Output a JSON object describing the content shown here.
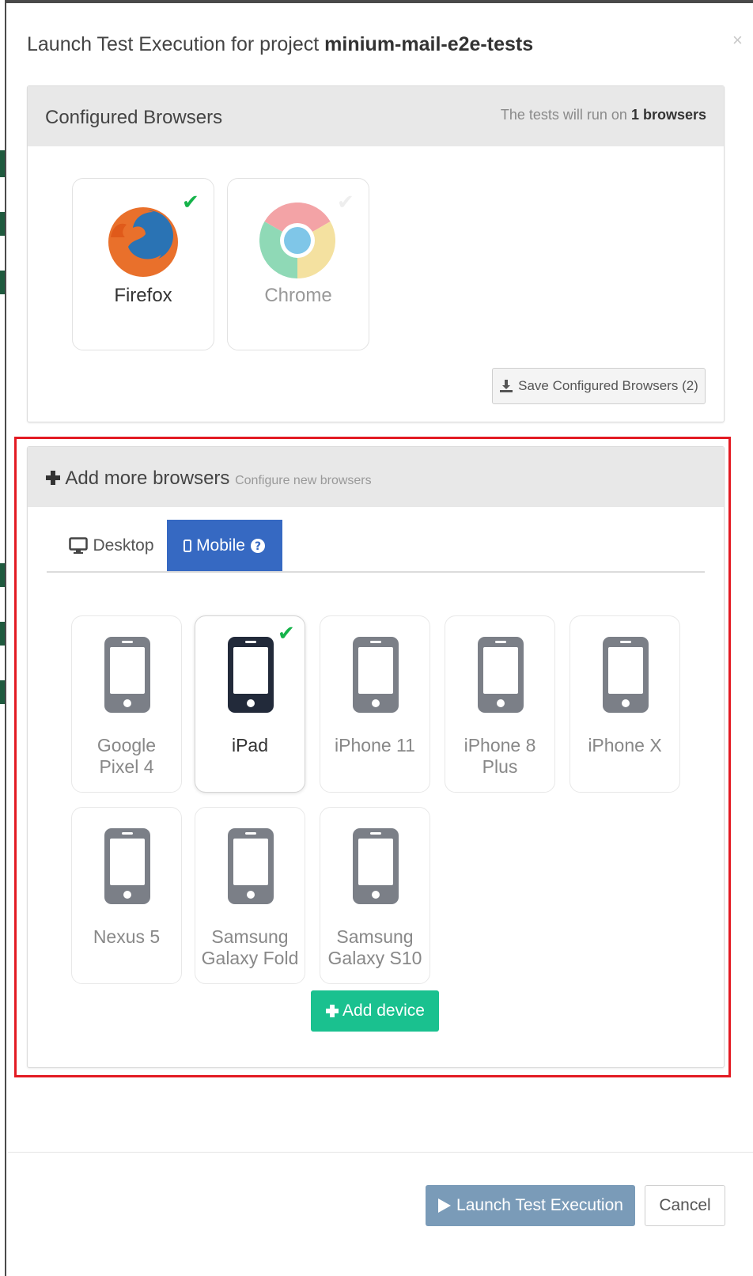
{
  "modal": {
    "title_prefix": "Launch Test Execution for project ",
    "project_name": "minium-mail-e2e-tests",
    "close_glyph": "×"
  },
  "configured": {
    "title": "Configured Browsers",
    "summary_prefix": "The tests will run on ",
    "summary_count": "1 browsers",
    "browsers": [
      {
        "name": "Firefox",
        "checked": true,
        "icon": "firefox-icon"
      },
      {
        "name": "Chrome",
        "checked": false,
        "icon": "chrome-icon"
      }
    ],
    "save_label": "Save Configured Browsers (2)",
    "save_icon": "download-icon"
  },
  "add_more": {
    "title": "Add more browsers",
    "subtitle": "Configure new browsers",
    "tabs": [
      {
        "label": "Desktop",
        "icon": "desktop-icon",
        "active": false
      },
      {
        "label": "Mobile",
        "icon": "mobile-icon",
        "active": true
      }
    ],
    "devices": [
      {
        "name": "Google Pixel 4",
        "line1": "Google",
        "line2": "Pixel 4",
        "selected": false
      },
      {
        "name": "iPad",
        "line1": "iPad",
        "line2": "",
        "selected": true
      },
      {
        "name": "iPhone 11",
        "line1": "iPhone 11",
        "line2": "",
        "selected": false
      },
      {
        "name": "iPhone 8 Plus",
        "line1": "iPhone 8",
        "line2": "Plus",
        "selected": false
      },
      {
        "name": "iPhone X",
        "line1": "iPhone X",
        "line2": "",
        "selected": false
      },
      {
        "name": "Nexus 5",
        "line1": "Nexus 5",
        "line2": "",
        "selected": false
      },
      {
        "name": "Samsung Galaxy Fold",
        "line1": "Samsung",
        "line2": "Galaxy Fold",
        "selected": false
      },
      {
        "name": "Samsung Galaxy S10",
        "line1": "Samsung",
        "line2": "Galaxy S10",
        "selected": false
      }
    ],
    "add_device_label": "Add device"
  },
  "footer": {
    "launch_label": "Launch Test Execution",
    "cancel_label": "Cancel"
  },
  "colors": {
    "accent_blue": "#3669c2",
    "success_green": "#1ac18f",
    "check_green": "#15b34a",
    "highlight_red": "#e31b23",
    "launch_disabled": "#7a9bb8"
  }
}
